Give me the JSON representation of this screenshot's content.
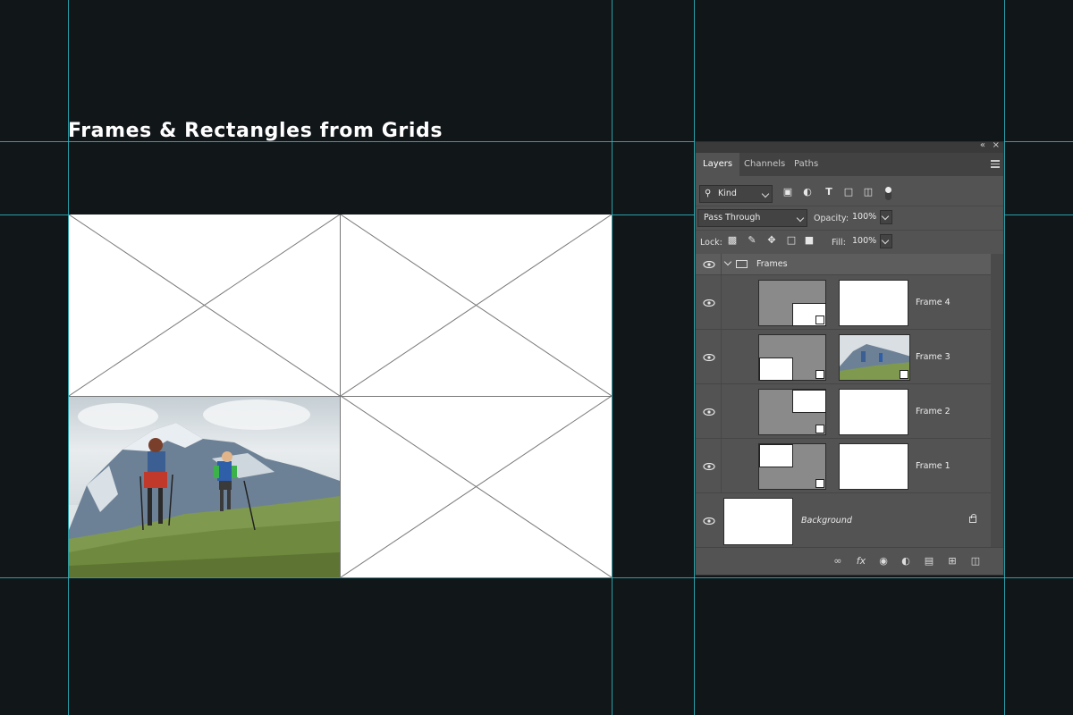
{
  "headline": "Frames & Rectangles from Grids",
  "frames": [
    "Frame 1",
    "Frame 2",
    "Frame 3",
    "Frame 4"
  ],
  "panel": {
    "tabs": [
      {
        "label": "Layers",
        "active": true
      },
      {
        "label": "Channels",
        "active": false
      },
      {
        "label": "Paths",
        "active": false
      }
    ],
    "filter": {
      "kind_label": "Kind"
    },
    "blend_mode": "Pass Through",
    "opacity_label": "Opacity:",
    "opacity_value": "100%",
    "lock_label": "Lock:",
    "fill_label": "Fill:",
    "fill_value": "100%",
    "group_name": "Frames",
    "layers": [
      {
        "name": "Frame 4",
        "has_photo": false
      },
      {
        "name": "Frame 3",
        "has_photo": true
      },
      {
        "name": "Frame 2",
        "has_photo": false
      },
      {
        "name": "Frame 1",
        "has_photo": false
      }
    ],
    "background_layer": "Background",
    "bottom_icons": [
      "link-icon",
      "fx-icon",
      "mask-icon",
      "adjustment-icon",
      "folder-icon",
      "new-layer-icon",
      "trash-icon"
    ]
  },
  "colors": {
    "canvas_bg": "#111619",
    "guide": "#2fb6c2",
    "panel_bg": "#535353"
  }
}
